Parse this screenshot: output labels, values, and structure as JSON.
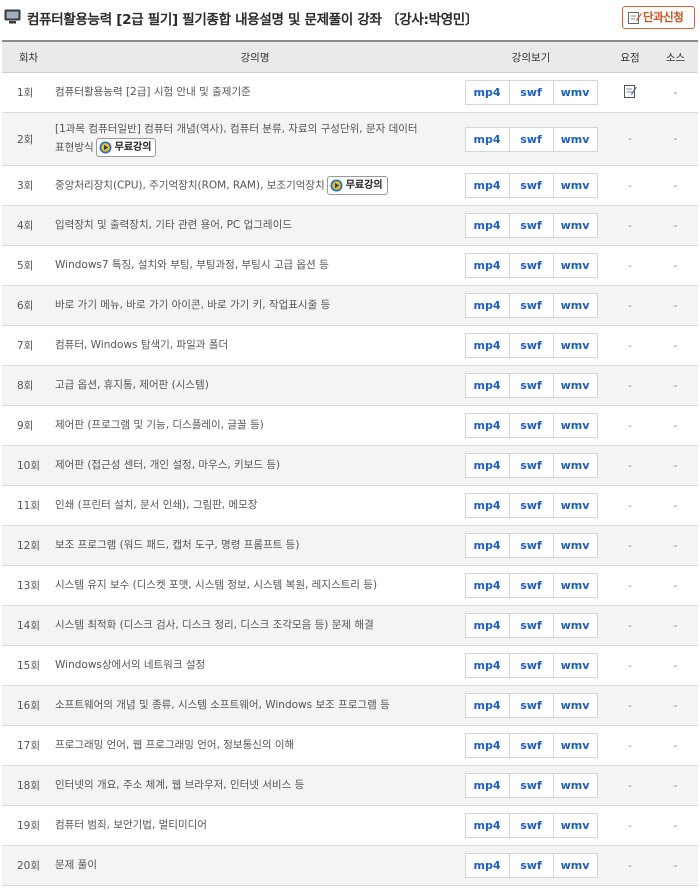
{
  "header": {
    "title": "컴퓨터활용능력 [2급 필기] 필기종합 내용설명 및 문제풀이 강좌 〔강사:박영민〕",
    "title_icon": "monitor-icon",
    "apply_button": {
      "label": "단과신청",
      "icon": "pencil-note-icon"
    }
  },
  "columns": {
    "num": "회차",
    "title": "강의명",
    "view": "강의보기",
    "memo": "요점",
    "source": "소스"
  },
  "formats": [
    "mp4",
    "swf",
    "wmv"
  ],
  "free_label": "무료강의",
  "colors": {
    "format_text": "#1a5fc4",
    "apply_accent": "#e0602a",
    "header_bg": "#eaeaea"
  },
  "rows": [
    {
      "num": "1회",
      "title": "컴퓨터활용능력 [2급] 시험 안내 및 출제기준",
      "title2": "",
      "free": false,
      "memo": "memo-icon",
      "source": "-"
    },
    {
      "num": "2회",
      "title": "[1과목 컴퓨터일반] 컴퓨터 개념(역사), 컴퓨터 분류, 자료의 구성단위, 문자 데이터",
      "title2": "표현방식",
      "free": true,
      "memo": "-",
      "source": "-"
    },
    {
      "num": "3회",
      "title": "중앙처리장치(CPU), 주기억장치(ROM, RAM), 보조기억장치",
      "title2": "",
      "free": true,
      "memo": "-",
      "source": "-"
    },
    {
      "num": "4회",
      "title": "입력장치 및 출력장치, 기타 관련 용어, PC 업그레이드",
      "title2": "",
      "free": false,
      "memo": "-",
      "source": "-"
    },
    {
      "num": "5회",
      "title": "Windows7 특징, 설치와 부팅, 부팅과정, 부팅시 고급 옵션 등",
      "title2": "",
      "free": false,
      "memo": "-",
      "source": "-"
    },
    {
      "num": "6회",
      "title": "바로 가기 메뉴, 바로 가기 아이콘, 바로 가기 키, 작업표시줄 등",
      "title2": "",
      "free": false,
      "memo": "-",
      "source": "-"
    },
    {
      "num": "7회",
      "title": "컴퓨터, Windows 탐색기, 파일과 폴더",
      "title2": "",
      "free": false,
      "memo": "-",
      "source": "-"
    },
    {
      "num": "8회",
      "title": "고급 옵션, 휴지통, 제어판 (시스템)",
      "title2": "",
      "free": false,
      "memo": "-",
      "source": "-"
    },
    {
      "num": "9회",
      "title": "제어판 (프로그램 및 기능, 디스플레이, 글꼴 등)",
      "title2": "",
      "free": false,
      "memo": "-",
      "source": "-"
    },
    {
      "num": "10회",
      "title": "제어판 (접근성 센터, 개인 설정, 마우스, 키보드 등)",
      "title2": "",
      "free": false,
      "memo": "-",
      "source": "-"
    },
    {
      "num": "11회",
      "title": "인쇄 (프린터 설치, 문서 인쇄), 그림판, 메모장",
      "title2": "",
      "free": false,
      "memo": "-",
      "source": "-"
    },
    {
      "num": "12회",
      "title": "보조 프로그램 (워드 패드, 캡처 도구, 명령 프롬프트 등)",
      "title2": "",
      "free": false,
      "memo": "-",
      "source": "-"
    },
    {
      "num": "13회",
      "title": "시스템 유지 보수 (디스켓 포맷, 시스템 정보, 시스템 복원, 레지스트리 등)",
      "title2": "",
      "free": false,
      "memo": "-",
      "source": "-"
    },
    {
      "num": "14회",
      "title": "시스템 최적화 (디스크 검사, 디스크 정리, 디스크 조각모음 등) 문제 해결",
      "title2": "",
      "free": false,
      "memo": "-",
      "source": "-"
    },
    {
      "num": "15회",
      "title": "Windows상에서의 네트워크 설정",
      "title2": "",
      "free": false,
      "memo": "-",
      "source": "-"
    },
    {
      "num": "16회",
      "title": "소프트웨어의 개념 및 종류, 시스템 소프트웨어, Windows 보조 프로그램 등",
      "title2": "",
      "free": false,
      "memo": "-",
      "source": "-"
    },
    {
      "num": "17회",
      "title": "프로그래밍 언어, 웹 프로그래밍 언어, 정보통신의 이해",
      "title2": "",
      "free": false,
      "memo": "-",
      "source": "-"
    },
    {
      "num": "18회",
      "title": "인터넷의 개요, 주소 체계, 웹 브라우저, 인터넷 서비스 등",
      "title2": "",
      "free": false,
      "memo": "-",
      "source": "-"
    },
    {
      "num": "19회",
      "title": "컴퓨터 범죄, 보안기법, 멀티미디어",
      "title2": "",
      "free": false,
      "memo": "-",
      "source": "-"
    },
    {
      "num": "20회",
      "title": "문제 풀이",
      "title2": "",
      "free": false,
      "memo": "-",
      "source": "-"
    }
  ]
}
